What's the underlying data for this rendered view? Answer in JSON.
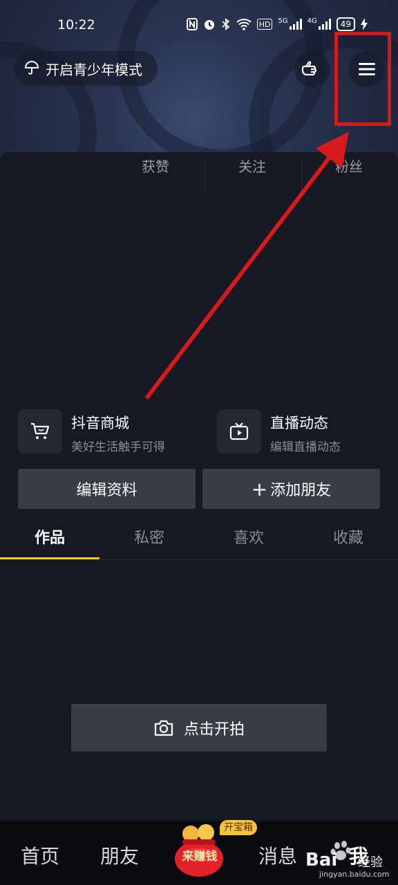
{
  "status_bar": {
    "time": "10:22",
    "icons": [
      "nfc-icon",
      "alarm-icon",
      "bluetooth-icon",
      "wifi-icon",
      "hd-icon",
      "5g-signal-icon",
      "4g-signal-icon"
    ],
    "hd_label": "HD",
    "net_5g": "5G",
    "net_4g": "4G",
    "battery": "49"
  },
  "header": {
    "youth_mode_label": "开启青少年模式"
  },
  "stats": {
    "likes_label": "获赞",
    "following_label": "关注",
    "followers_label": "粉丝"
  },
  "features": [
    {
      "title": "抖音商城",
      "subtitle": "美好生活触手可得",
      "icon": "cart-icon"
    },
    {
      "title": "直播动态",
      "subtitle": "编辑直播动态",
      "icon": "tv-icon"
    }
  ],
  "buttons": {
    "edit_profile": "编辑资料",
    "add_friend": "添加朋友",
    "add_friend_prefix": "+"
  },
  "tabs": [
    {
      "label": "作品",
      "active": true
    },
    {
      "label": "私密",
      "active": false
    },
    {
      "label": "喜欢",
      "active": false
    },
    {
      "label": "收藏",
      "active": false
    }
  ],
  "shoot": {
    "label": "点击开拍"
  },
  "bottom_nav": {
    "home": "首页",
    "friends": "朋友",
    "earn": "来赚钱",
    "treasure_badge": "开宝箱",
    "messages": "消息",
    "me": "我"
  },
  "watermark": {
    "brand": "Bai",
    "brand_suffix": "经验",
    "url": "jingyan.baidu.com"
  },
  "colors": {
    "accent": "#face15",
    "annotation": "#d61a1a",
    "panel": "#161823",
    "button": "#393b45"
  }
}
